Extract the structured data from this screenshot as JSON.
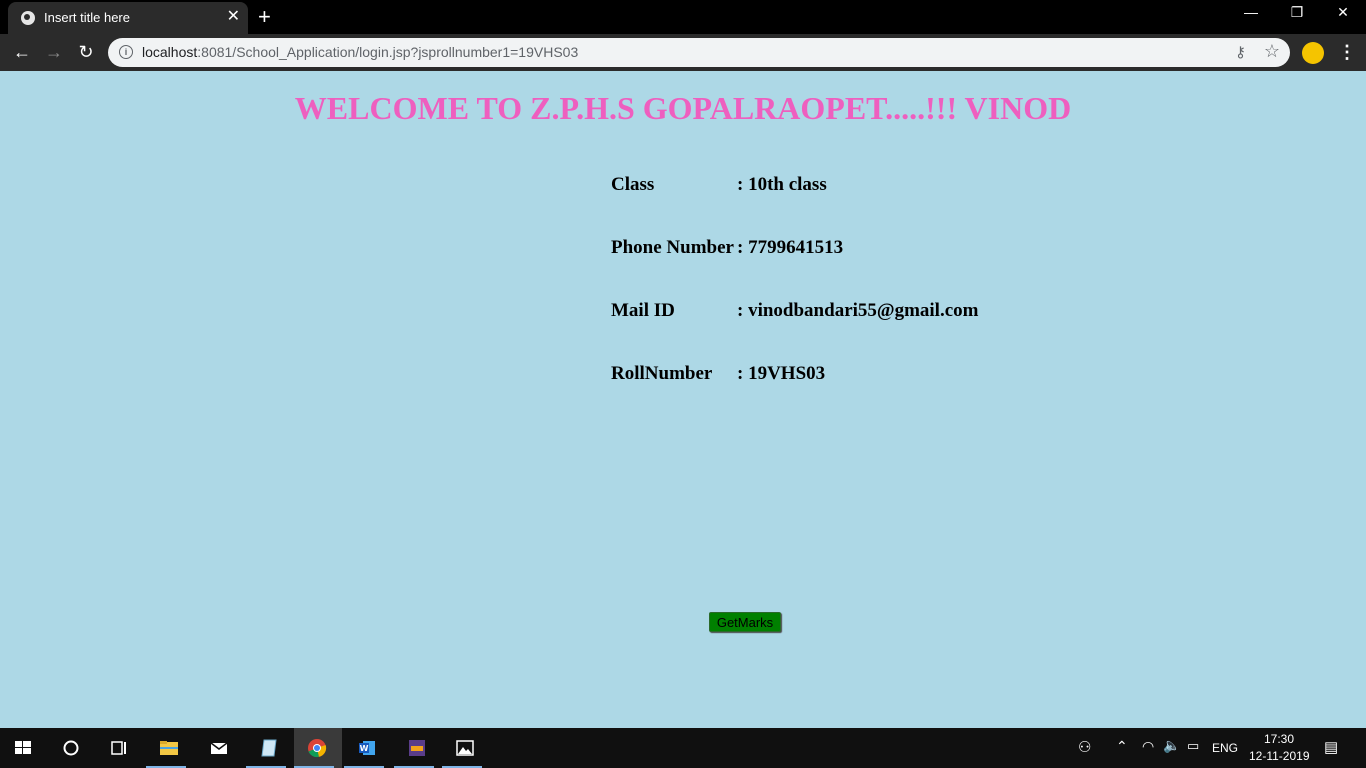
{
  "browser": {
    "tab_title": "Insert title here",
    "tab_close": "✕",
    "new_tab": "+",
    "window_controls": {
      "minimize": "—",
      "restore": "❐",
      "close": "✕"
    },
    "url_host": "localhost",
    "url_rest": ":8081/School_Application/login.jsp?jsprollnumber1=19VHS03"
  },
  "page": {
    "heading": "WELCOME TO Z.P.H.S GOPALRAOPET.....!!! VINOD",
    "fields": [
      {
        "label": "Class",
        "value": ": 10th class"
      },
      {
        "label": "Phone Number",
        "value": ": 7799641513"
      },
      {
        "label": "Mail ID",
        "value": ": vinodbandari55@gmail.com"
      },
      {
        "label": "RollNumber",
        "value": ": 19VHS03"
      }
    ],
    "button_label": "GetMarks"
  },
  "taskbar": {
    "language": "ENG",
    "time": "17:30",
    "date": "12-11-2019"
  },
  "colors": {
    "page_background": "#add8e6",
    "heading": "#ee5fbf",
    "button": "#008000"
  }
}
